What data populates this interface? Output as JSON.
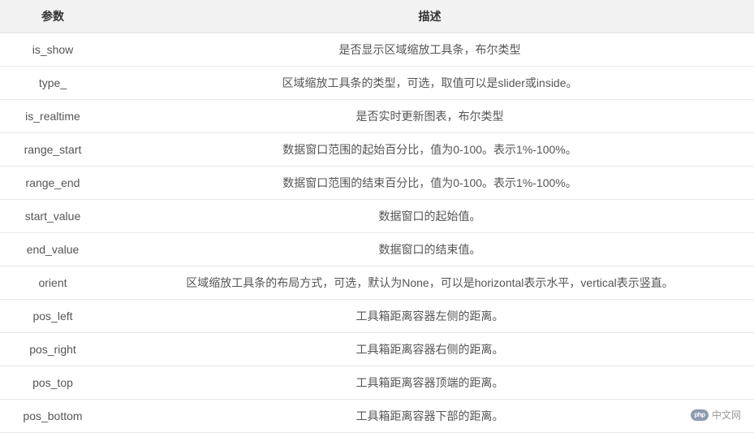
{
  "table": {
    "headers": [
      "参数",
      "描述"
    ],
    "rows": [
      {
        "param": "is_show",
        "desc": "是否显示区域缩放工具条，布尔类型"
      },
      {
        "param": "type_",
        "desc": "区域缩放工具条的类型，可选，取值可以是slider或inside。"
      },
      {
        "param": "is_realtime",
        "desc": "是否实时更新图表，布尔类型"
      },
      {
        "param": "range_start",
        "desc": "数据窗口范围的起始百分比，值为0-100。表示1%-100%。"
      },
      {
        "param": "range_end",
        "desc": "数据窗口范围的结束百分比，值为0-100。表示1%-100%。"
      },
      {
        "param": "start_value",
        "desc": "数据窗口的起始值。"
      },
      {
        "param": "end_value",
        "desc": "数据窗口的结束值。"
      },
      {
        "param": "orient",
        "desc": "区域缩放工具条的布局方式，可选，默认为None，可以是horizontal表示水平，vertical表示竖直。"
      },
      {
        "param": "pos_left",
        "desc": "工具箱距离容器左侧的距离。"
      },
      {
        "param": "pos_right",
        "desc": "工具箱距离容器右侧的距离。"
      },
      {
        "param": "pos_top",
        "desc": "工具箱距离容器顶端的距离。"
      },
      {
        "param": "pos_bottom",
        "desc": "工具箱距离容器下部的距离。"
      }
    ]
  },
  "watermark": {
    "logo": "php",
    "text": "中文网"
  }
}
